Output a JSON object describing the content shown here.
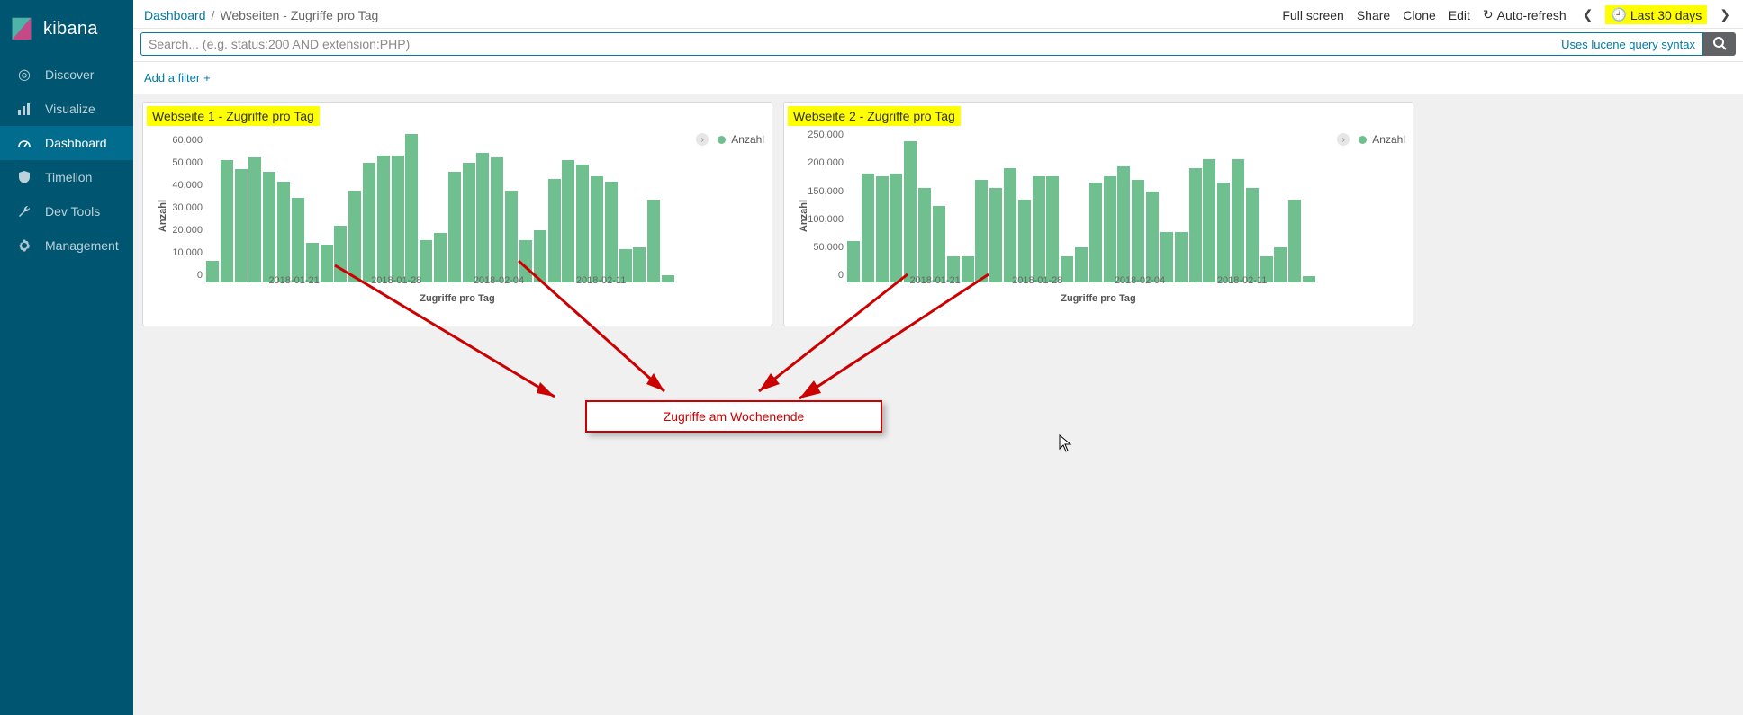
{
  "brand": "kibana",
  "nav": [
    {
      "key": "discover",
      "label": "Discover",
      "icon": "compass"
    },
    {
      "key": "visualize",
      "label": "Visualize",
      "icon": "bar-chart"
    },
    {
      "key": "dashboard",
      "label": "Dashboard",
      "icon": "gauge",
      "active": true
    },
    {
      "key": "timelion",
      "label": "Timelion",
      "icon": "shield"
    },
    {
      "key": "devtools",
      "label": "Dev Tools",
      "icon": "wrench"
    },
    {
      "key": "management",
      "label": "Management",
      "icon": "gear"
    }
  ],
  "breadcrumb": {
    "root": "Dashboard",
    "current": "Webseiten - Zugriffe pro Tag"
  },
  "top_actions": {
    "fullscreen": "Full screen",
    "share": "Share",
    "clone": "Clone",
    "edit": "Edit",
    "autorefresh": "Auto-refresh",
    "timerange": "Last 30 days"
  },
  "search": {
    "placeholder": "Search... (e.g. status:200 AND extension:PHP)",
    "value": "",
    "hint": "Uses lucene query syntax"
  },
  "filterbar": {
    "add": "Add a filter"
  },
  "panels": [
    {
      "key": "web1",
      "title": "Webseite 1 - Zugriffe pro Tag"
    },
    {
      "key": "web2",
      "title": "Webseite 2 - Zugriffe pro Tag"
    }
  ],
  "legend_label": "Anzahl",
  "chart_data": [
    {
      "panel": "web1",
      "type": "bar",
      "title": "Webseite 1 - Zugriffe pro Tag",
      "xlabel": "Zugriffe pro Tag",
      "ylabel": "Anzahl",
      "ylim": [
        0,
        65000
      ],
      "yticks": [
        0,
        10000,
        20000,
        30000,
        40000,
        50000,
        60000
      ],
      "yticklabels": [
        "0",
        "10,000",
        "20,000",
        "30,000",
        "40,000",
        "50,000",
        "60,000"
      ],
      "xticklabels": [
        "2018-01-21",
        "2018-01-28",
        "2018-02-04",
        "2018-02-11"
      ],
      "xtick_indices": [
        6,
        13,
        20,
        27
      ],
      "series": [
        {
          "name": "Anzahl",
          "values": [
            9000,
            52000,
            48000,
            53000,
            47000,
            43000,
            36000,
            17000,
            16000,
            24000,
            39000,
            51000,
            54000,
            54000,
            63000,
            18000,
            21000,
            47000,
            51000,
            55000,
            53000,
            39000,
            18000,
            22000,
            44000,
            52000,
            50000,
            45000,
            43000,
            14000,
            15000,
            35000,
            3000
          ]
        }
      ]
    },
    {
      "panel": "web2",
      "type": "bar",
      "title": "Webseite 2 - Zugriffe pro Tag",
      "xlabel": "Zugriffe pro Tag",
      "ylabel": "Anzahl",
      "ylim": [
        0,
        260000
      ],
      "yticks": [
        0,
        50000,
        100000,
        150000,
        200000,
        250000
      ],
      "yticklabels": [
        "0",
        "50,000",
        "100,000",
        "150,000",
        "200,000",
        "250,000"
      ],
      "xticklabels": [
        "2018-01-21",
        "2018-01-28",
        "2018-02-04",
        "2018-02-11"
      ],
      "xtick_indices": [
        6,
        13,
        20,
        27
      ],
      "series": [
        {
          "name": "Anzahl",
          "values": [
            70000,
            185000,
            180000,
            185000,
            240000,
            160000,
            130000,
            45000,
            45000,
            175000,
            160000,
            195000,
            140000,
            180000,
            180000,
            45000,
            60000,
            170000,
            180000,
            198000,
            175000,
            155000,
            85000,
            85000,
            195000,
            210000,
            170000,
            210000,
            160000,
            45000,
            60000,
            140000,
            10000
          ]
        }
      ]
    }
  ],
  "annotation": {
    "label": "Zugriffe am Wochenende"
  }
}
